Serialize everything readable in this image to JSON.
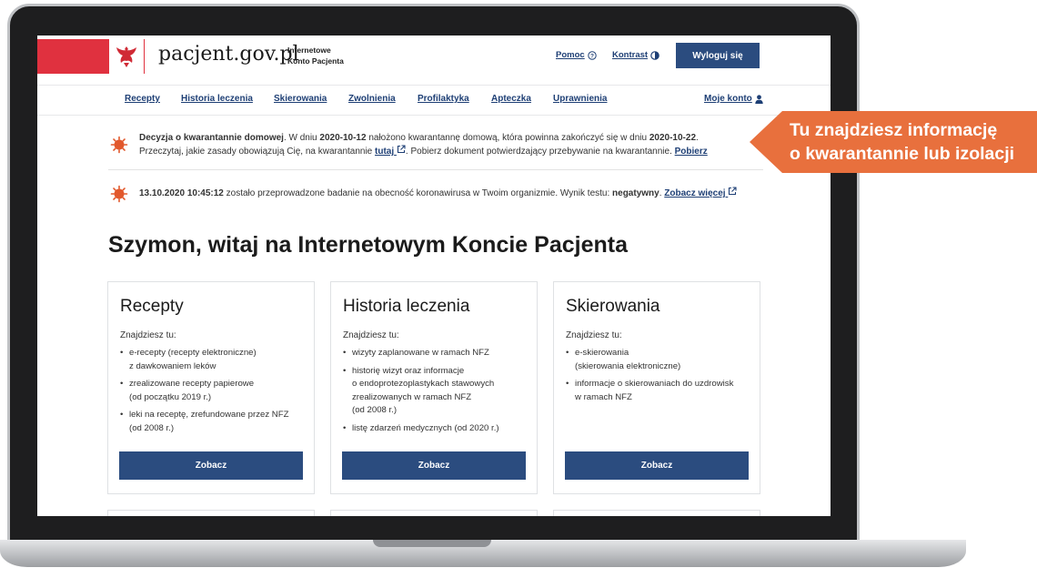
{
  "header": {
    "site_name": "pacjent.gov.pl",
    "subtitle_line1": "Internetowe",
    "subtitle_line2": "Konto Pacjenta",
    "help_label": "Pomoc",
    "contrast_label": "Kontrast",
    "logout_label": "Wyloguj się"
  },
  "nav": {
    "items": [
      "Recepty",
      "Historia leczenia",
      "Skierowania",
      "Zwolnienia",
      "Profilaktyka",
      "Apteczka",
      "Uprawnienia"
    ],
    "account_label": "Moje konto"
  },
  "notices": {
    "quarantine": {
      "title": "Decyzja o kwarantannie domowej",
      "text1": ". W dniu ",
      "date_start": "2020-10-12",
      "text2": " nałożono kwarantannę domową, która powinna zakończyć się w dniu ",
      "date_end": "2020-10-22",
      "text3": ".",
      "line2_text": "Przeczytaj, jakie zasady obowiązują Cię, na kwarantannie ",
      "link_here": "tutaj",
      "line2_text2": ". Pobierz dokument potwierdzający przebywanie na kwarantannie. ",
      "link_download": "Pobierz"
    },
    "test": {
      "datetime": "13.10.2020 10:45:12",
      "text1": " zostało przeprowadzone badanie na obecność koronawirusa w Twoim organizmie. Wynik testu: ",
      "result": "negatywny",
      "text2": ". ",
      "link_more": "Zobacz więcej"
    }
  },
  "welcome": "Szymon, witaj na Internetowym Koncie Pacjenta",
  "cards": [
    {
      "title": "Recepty",
      "intro": "Znajdziesz tu:",
      "items": [
        [
          "e-recepty (recepty elektroniczne)",
          "z dawkowaniem leków"
        ],
        [
          "zrealizowane recepty papierowe",
          "(od początku 2019 r.)"
        ],
        [
          "leki na receptę, zrefundowane przez NFZ",
          "(od 2008 r.)"
        ]
      ],
      "button": "Zobacz"
    },
    {
      "title": "Historia leczenia",
      "intro": "Znajdziesz tu:",
      "items": [
        [
          "wizyty zaplanowane w ramach NFZ"
        ],
        [
          "historię wizyt oraz informacje",
          "o endoprotezoplastykach stawowych",
          "zrealizowanych w ramach NFZ",
          "(od 2008 r.)"
        ],
        [
          "listę zdarzeń medycznych (od 2020 r.)"
        ]
      ],
      "button": "Zobacz"
    },
    {
      "title": "Skierowania",
      "intro": "Znajdziesz tu:",
      "items": [
        [
          "e-skierowania",
          "(skierowania elektroniczne)"
        ],
        [
          "informacje o skierowaniach do uzdrowisk",
          "w ramach NFZ"
        ]
      ],
      "button": "Zobacz"
    }
  ],
  "callout": {
    "line1": "Tu znajdziesz informację",
    "line2": "o kwarantannie lub izolacji",
    "color": "#e8703d"
  },
  "colors": {
    "primary": "#2b4c7f",
    "link": "#1e3f75",
    "flag_red": "#e0313f",
    "virus": "#e2582c"
  }
}
